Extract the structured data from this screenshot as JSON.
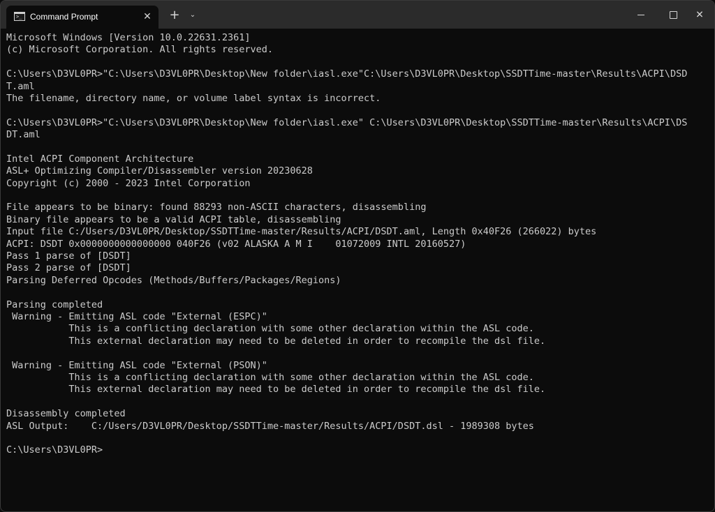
{
  "titlebar": {
    "tab_title": "Command Prompt",
    "tab_icon": "cmd-prompt-icon",
    "close_tab_icon": "close-icon",
    "new_tab_label": "+",
    "dropdown_icon": "chevron-down-icon",
    "minimize_icon": "minimize-icon",
    "maximize_icon": "maximize-icon",
    "close_window_icon": "close-icon"
  },
  "console": {
    "foreground": "#cccccc",
    "background": "#0c0c0c",
    "lines": [
      "Microsoft Windows [Version 10.0.22631.2361]",
      "(c) Microsoft Corporation. All rights reserved.",
      "",
      "C:\\Users\\D3VL0PR>\"C:\\Users\\D3VL0PR\\Desktop\\New folder\\iasl.exe\"C:\\Users\\D3VL0PR\\Desktop\\SSDTTime-master\\Results\\ACPI\\DSD",
      "T.aml",
      "The filename, directory name, or volume label syntax is incorrect.",
      "",
      "C:\\Users\\D3VL0PR>\"C:\\Users\\D3VL0PR\\Desktop\\New folder\\iasl.exe\" C:\\Users\\D3VL0PR\\Desktop\\SSDTTime-master\\Results\\ACPI\\DS",
      "DT.aml",
      "",
      "Intel ACPI Component Architecture",
      "ASL+ Optimizing Compiler/Disassembler version 20230628",
      "Copyright (c) 2000 - 2023 Intel Corporation",
      "",
      "File appears to be binary: found 88293 non-ASCII characters, disassembling",
      "Binary file appears to be a valid ACPI table, disassembling",
      "Input file C:/Users/D3VL0PR/Desktop/SSDTTime-master/Results/ACPI/DSDT.aml, Length 0x40F26 (266022) bytes",
      "ACPI: DSDT 0x0000000000000000 040F26 (v02 ALASKA A M I    01072009 INTL 20160527)",
      "Pass 1 parse of [DSDT]",
      "Pass 2 parse of [DSDT]",
      "Parsing Deferred Opcodes (Methods/Buffers/Packages/Regions)",
      "",
      "Parsing completed",
      " Warning - Emitting ASL code \"External (ESPC)\"",
      "           This is a conflicting declaration with some other declaration within the ASL code.",
      "           This external declaration may need to be deleted in order to recompile the dsl file.",
      "",
      " Warning - Emitting ASL code \"External (PSON)\"",
      "           This is a conflicting declaration with some other declaration within the ASL code.",
      "           This external declaration may need to be deleted in order to recompile the dsl file.",
      "",
      "Disassembly completed",
      "ASL Output:    C:/Users/D3VL0PR/Desktop/SSDTTime-master/Results/ACPI/DSDT.dsl - 1989308 bytes",
      "",
      "C:\\Users\\D3VL0PR>"
    ]
  }
}
